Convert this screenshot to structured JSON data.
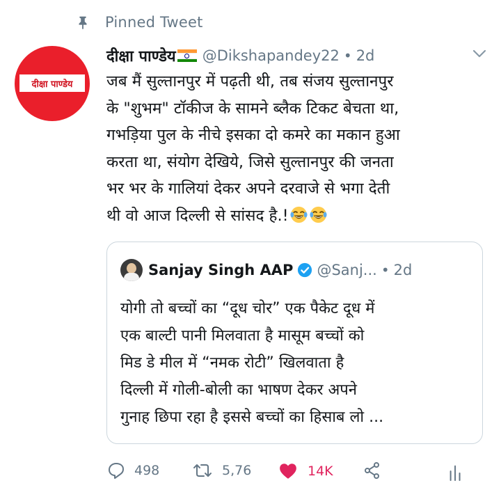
{
  "pinned": {
    "label": "Pinned Tweet",
    "icon": "pin-icon"
  },
  "tweet": {
    "avatar_text": "दीक्षा पाण्डेय",
    "display_name": "दीक्षा पाण्डेय",
    "handle": "@Dikshapandey22",
    "separator": "•",
    "time": "2d",
    "text": "जब मैं सुल्तानपुर में पढ़ती थी, तब संजय सुल्तानपुर\nके \"शुभम\" टॉकीज के सामने ब्लैक टिकट बेचता था,\nगभड़िया पुल के नीचे इसका दो कमरे का मकान हुआ\nकरता था, संयोग देखिये, जिसे सुल्तानपुर की जनता\nभर भर के गालियां देकर अपने दरवाजे से भगा देती\nथी वो आज दिल्ली से सांसद है.!",
    "emojis": [
      "face-with-tears-of-joy",
      "face-with-tears-of-joy"
    ],
    "flag_colors": [
      "#ff9933",
      "#ffffff",
      "#138808"
    ]
  },
  "quoted": {
    "display_name": "Sanjay Singh AAP",
    "handle": "@Sanj...",
    "separator": "•",
    "time": "2d",
    "text": "योगी तो बच्चों का “दूध चोर” एक पैकेट दूध में\nएक बाल्टी पानी मिलवाता है मासूम बच्चों को\nमिड डे मील में “नमक रोटी” खिलवाता है\nदिल्ली में गोली-बोली का भाषण देकर अपने\nगुनाह छिपा रहा है इससे बच्चों का हिसाब लो ...",
    "verified_color": "#1da1f2"
  },
  "actions": {
    "reply_count": "498",
    "retweet_count": "5,76",
    "like_count": "14K",
    "like_color": "#e0245e",
    "icons": [
      "reply-icon",
      "retweet-icon",
      "heart-icon",
      "share-icon",
      "analytics-icon"
    ]
  }
}
